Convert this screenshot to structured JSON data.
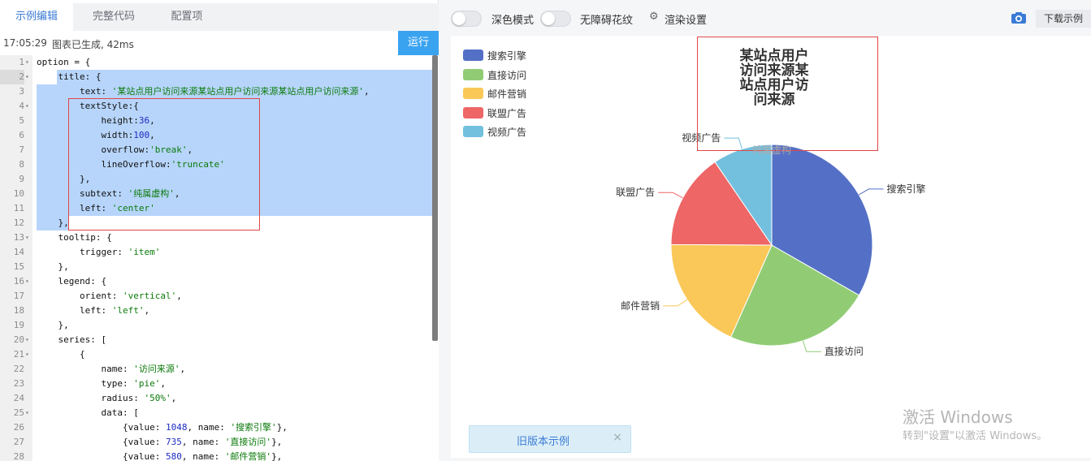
{
  "tabs": [
    "示例编辑",
    "完整代码",
    "配置项"
  ],
  "status": {
    "time": "17:05:29",
    "message": "图表已生成, 42ms"
  },
  "run_label": "运行",
  "code_lines": [
    {
      "n": "1",
      "fold": "▾",
      "segs": [
        [
          "k",
          "option = {"
        ]
      ]
    },
    {
      "n": "2",
      "fold": "▾",
      "segs": [
        [
          "k",
          "    title: {"
        ]
      ]
    },
    {
      "n": "3",
      "fold": "",
      "segs": [
        [
          "k",
          "        text: "
        ],
        [
          "s",
          "'某站点用户访问来源某站点用户访问来源某站点用户访问来源'"
        ],
        [
          "k",
          ","
        ]
      ]
    },
    {
      "n": "4",
      "fold": "▾",
      "segs": [
        [
          "k",
          "        textStyle:{"
        ]
      ]
    },
    {
      "n": "5",
      "fold": "",
      "segs": [
        [
          "k",
          "            height:"
        ],
        [
          "n",
          "36"
        ],
        [
          "k",
          ","
        ]
      ]
    },
    {
      "n": "6",
      "fold": "",
      "segs": [
        [
          "k",
          "            width:"
        ],
        [
          "n",
          "100"
        ],
        [
          "k",
          ","
        ]
      ]
    },
    {
      "n": "7",
      "fold": "",
      "segs": [
        [
          "k",
          "            overflow:"
        ],
        [
          "s",
          "'break'"
        ],
        [
          "k",
          ","
        ]
      ]
    },
    {
      "n": "8",
      "fold": "",
      "segs": [
        [
          "k",
          "            lineOverflow:"
        ],
        [
          "s",
          "'truncate'"
        ]
      ]
    },
    {
      "n": "9",
      "fold": "",
      "segs": [
        [
          "k",
          "        },"
        ]
      ]
    },
    {
      "n": "10",
      "fold": "",
      "segs": [
        [
          "k",
          "        subtext: "
        ],
        [
          "s",
          "'纯属虚构'"
        ],
        [
          "k",
          ","
        ]
      ]
    },
    {
      "n": "11",
      "fold": "",
      "segs": [
        [
          "k",
          "        left: "
        ],
        [
          "s",
          "'center'"
        ]
      ]
    },
    {
      "n": "12",
      "fold": "",
      "segs": [
        [
          "k",
          "    },"
        ]
      ]
    },
    {
      "n": "13",
      "fold": "▾",
      "segs": [
        [
          "k",
          "    tooltip: {"
        ]
      ]
    },
    {
      "n": "14",
      "fold": "",
      "segs": [
        [
          "k",
          "        trigger: "
        ],
        [
          "s",
          "'item'"
        ]
      ]
    },
    {
      "n": "15",
      "fold": "",
      "segs": [
        [
          "k",
          "    },"
        ]
      ]
    },
    {
      "n": "16",
      "fold": "▾",
      "segs": [
        [
          "k",
          "    legend: {"
        ]
      ]
    },
    {
      "n": "17",
      "fold": "",
      "segs": [
        [
          "k",
          "        orient: "
        ],
        [
          "s",
          "'vertical'"
        ],
        [
          "k",
          ","
        ]
      ]
    },
    {
      "n": "18",
      "fold": "",
      "segs": [
        [
          "k",
          "        left: "
        ],
        [
          "s",
          "'left'"
        ],
        [
          "k",
          ","
        ]
      ]
    },
    {
      "n": "19",
      "fold": "",
      "segs": [
        [
          "k",
          "    },"
        ]
      ]
    },
    {
      "n": "20",
      "fold": "▾",
      "segs": [
        [
          "k",
          "    series: ["
        ]
      ]
    },
    {
      "n": "21",
      "fold": "▾",
      "segs": [
        [
          "k",
          "        {"
        ]
      ]
    },
    {
      "n": "22",
      "fold": "",
      "segs": [
        [
          "k",
          "            name: "
        ],
        [
          "s",
          "'访问来源'"
        ],
        [
          "k",
          ","
        ]
      ]
    },
    {
      "n": "23",
      "fold": "",
      "segs": [
        [
          "k",
          "            type: "
        ],
        [
          "s",
          "'pie'"
        ],
        [
          "k",
          ","
        ]
      ]
    },
    {
      "n": "24",
      "fold": "",
      "segs": [
        [
          "k",
          "            radius: "
        ],
        [
          "s",
          "'50%'"
        ],
        [
          "k",
          ","
        ]
      ]
    },
    {
      "n": "25",
      "fold": "▾",
      "segs": [
        [
          "k",
          "            data: ["
        ]
      ]
    },
    {
      "n": "26",
      "fold": "",
      "segs": [
        [
          "k",
          "                {value: "
        ],
        [
          "n",
          "1048"
        ],
        [
          "k",
          ", name: "
        ],
        [
          "s",
          "'搜索引擎'"
        ],
        [
          "k",
          "},"
        ]
      ]
    },
    {
      "n": "27",
      "fold": "",
      "segs": [
        [
          "k",
          "                {value: "
        ],
        [
          "n",
          "735"
        ],
        [
          "k",
          ", name: "
        ],
        [
          "s",
          "'直接访问'"
        ],
        [
          "k",
          "},"
        ]
      ]
    },
    {
      "n": "28",
      "fold": "",
      "segs": [
        [
          "k",
          "                {value: "
        ],
        [
          "n",
          "580"
        ],
        [
          "k",
          ", name: "
        ],
        [
          "s",
          "'邮件营销'"
        ],
        [
          "k",
          "},"
        ]
      ]
    }
  ],
  "toolbar": {
    "dark_mode_label": "深色模式",
    "accessibility_label": "无障碍花纹",
    "render_settings_label": "渲染设置",
    "render_settings_icon": "gear-icon",
    "screenshot_icon": "camera-icon",
    "download_label": "下载示例"
  },
  "chart_data": {
    "type": "pie",
    "title": "某站点用户访问来源某站点用户访问来源",
    "subtitle": "纯属虚构",
    "legend_position": "top-left",
    "series": [
      {
        "name": "访问来源",
        "values": [
          1048,
          735,
          580,
          484,
          300
        ]
      }
    ],
    "categories": [
      "搜索引擎",
      "直接访问",
      "邮件营销",
      "联盟广告",
      "视频广告"
    ],
    "colors": [
      "#5470c6",
      "#91cc75",
      "#fac858",
      "#ee6666",
      "#73c0de"
    ]
  },
  "old_example_label": "旧版本示例",
  "close_icon": "close-icon",
  "watermark": {
    "line1": "激活 Windows",
    "line2": "转到\"设置\"以激活 Windows。"
  }
}
